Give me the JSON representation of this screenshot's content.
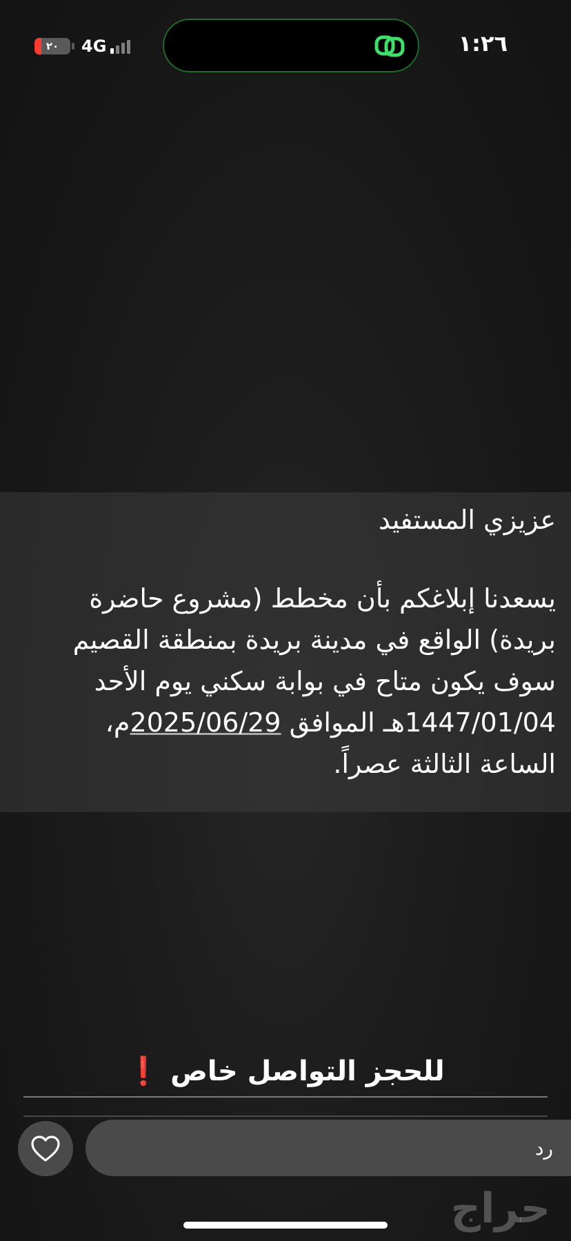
{
  "status_bar": {
    "time": "١:٢٦",
    "battery_level": "٢٠",
    "battery_fraction": 0.2,
    "network": "4G",
    "battery_color": "#ff3b30",
    "island_icon": "link-rings-icon",
    "island_icon_color": "#3fe06a"
  },
  "message": {
    "greeting": "عزيزي المستفيد",
    "body_before_date": "يسعدنا إبلاغكم بأن مخطط (مشروع حاضرة بريدة) الواقع في مدينة بريدة بمنطقة القصيم سوف يكون متاح في بوابة سكني يوم الأحد 1447/01/04هـ الموافق ",
    "date": "2025/06/29",
    "body_after_date": "م، الساعة الثالثة عصراً."
  },
  "caption": {
    "text": "للحجز التواصل خاص ",
    "icon": "exclamation-mark-icon",
    "icon_glyph": "❗"
  },
  "reply": {
    "placeholder": "رد",
    "like_icon": "heart-icon"
  },
  "watermark": {
    "text": "حراج"
  }
}
